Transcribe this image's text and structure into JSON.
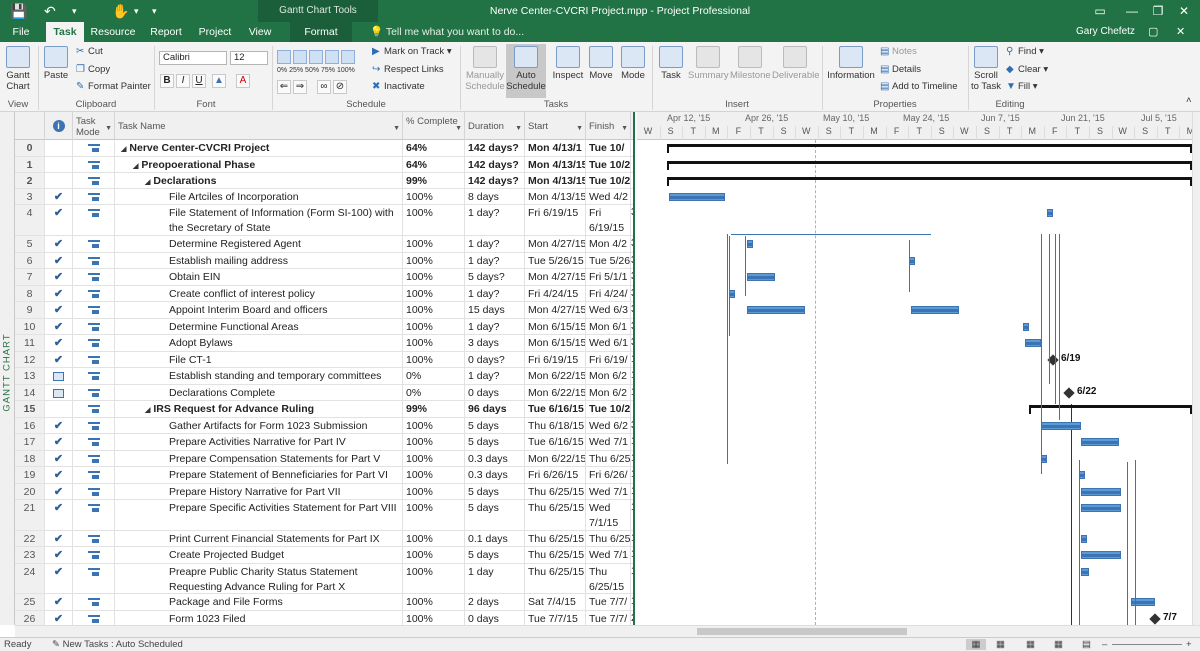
{
  "window": {
    "title": "Nerve Center-CVCRI Project.mpp - Project Professional",
    "context_tab_group": "Gantt Chart Tools",
    "user": "Gary Chefetz"
  },
  "tabs": [
    {
      "label": "File"
    },
    {
      "label": "Task",
      "active": true
    },
    {
      "label": "Resource"
    },
    {
      "label": "Report"
    },
    {
      "label": "Project"
    },
    {
      "label": "View"
    },
    {
      "label": "Format"
    }
  ],
  "tell_me": "Tell me what you want to do...",
  "ribbon": {
    "view": {
      "gantt": "Gantt Chart",
      "group": "View"
    },
    "clipboard": {
      "paste": "Paste",
      "cut": "Cut",
      "copy": "Copy",
      "painter": "Format Painter",
      "group": "Clipboard"
    },
    "font": {
      "name": "Calibri",
      "size": "12",
      "bold": "B",
      "italic": "I",
      "underline": "U",
      "group": "Font"
    },
    "schedule": {
      "mark_on_track": "Mark on Track",
      "respect_links": "Respect Links",
      "inactivate": "Inactivate",
      "pct": [
        "0%",
        "25%",
        "50%",
        "75%",
        "100%"
      ],
      "group": "Schedule"
    },
    "tasks": {
      "manually": "Manually Schedule",
      "auto": "Auto Schedule",
      "inspect": "Inspect",
      "move": "Move",
      "mode": "Mode",
      "group": "Tasks"
    },
    "insert": {
      "task": "Task",
      "summary": "Summary",
      "milestone": "Milestone",
      "deliverable": "Deliverable",
      "group": "Insert"
    },
    "properties": {
      "information": "Information",
      "notes": "Notes",
      "details": "Details",
      "add_timeline": "Add to Timeline",
      "group": "Properties"
    },
    "editing": {
      "scroll": "Scroll to Task",
      "find": "Find",
      "clear": "Clear",
      "fill": "Fill",
      "group": "Editing"
    }
  },
  "side_label": "GANTT CHART",
  "columns": {
    "info": "i",
    "mode": "Task Mode",
    "name": "Task Name",
    "pct": "% Complete",
    "duration": "Duration",
    "start": "Start",
    "finish": "Finish",
    "pred": "P"
  },
  "rows": [
    {
      "id": "0",
      "check": false,
      "level": 0,
      "summary": true,
      "name": "Nerve Center-CVCRI Project",
      "pct": "64%",
      "duration": "142 days?",
      "start": "Mon 4/13/1",
      "finish": "Tue 10/",
      "pred": "",
      "h": 17
    },
    {
      "id": "1",
      "check": false,
      "level": 1,
      "summary": true,
      "name": "Preopoerational Phase",
      "pct": "64%",
      "duration": "142 days?",
      "start": "Mon 4/13/15",
      "finish": "Tue 10/2",
      "pred": "",
      "h": 16
    },
    {
      "id": "2",
      "check": false,
      "level": 2,
      "summary": true,
      "name": "Declarations",
      "pct": "99%",
      "duration": "142 days?",
      "start": "Mon 4/13/15",
      "finish": "Tue 10/2",
      "pred": "",
      "h": 16
    },
    {
      "id": "3",
      "check": true,
      "level": 3,
      "summary": false,
      "name": "File Artciles of Incorporation",
      "pct": "100%",
      "duration": "8 days",
      "start": "Mon 4/13/15",
      "finish": "Wed 4/2",
      "pred": "",
      "h": 16
    },
    {
      "id": "4",
      "check": true,
      "level": 3,
      "summary": false,
      "name": "File Statement of Information (Form SI-100) with the Secretary of State",
      "pct": "100%",
      "duration": "1 day?",
      "start": "Fri 6/19/15",
      "finish": "Fri 6/19/15",
      "pred": "3",
      "h": 31
    },
    {
      "id": "5",
      "check": true,
      "level": 3,
      "summary": false,
      "name": "Determine Registered Agent",
      "pct": "100%",
      "duration": "1 day?",
      "start": "Mon 4/27/15",
      "finish": "Mon 4/2",
      "pred": "3",
      "h": 17
    },
    {
      "id": "6",
      "check": true,
      "level": 3,
      "summary": false,
      "name": "Establish mailing address",
      "pct": "100%",
      "duration": "1 day?",
      "start": "Tue 5/26/15",
      "finish": "Tue 5/26",
      "pred": "3",
      "h": 16
    },
    {
      "id": "7",
      "check": true,
      "level": 3,
      "summary": false,
      "name": "Obtain EIN",
      "pct": "100%",
      "duration": "5 days?",
      "start": "Mon 4/27/15",
      "finish": "Fri 5/1/1",
      "pred": "3",
      "h": 17
    },
    {
      "id": "8",
      "check": true,
      "level": 3,
      "summary": false,
      "name": "Create conflict of interest policy",
      "pct": "100%",
      "duration": "1 day?",
      "start": "Fri 4/24/15",
      "finish": "Fri 4/24/",
      "pred": "3",
      "h": 16
    },
    {
      "id": "9",
      "check": true,
      "level": 3,
      "summary": false,
      "name": "Appoint Interim Board and officers",
      "pct": "100%",
      "duration": "15 days",
      "start": "Mon 4/27/15",
      "finish": "Wed 6/3",
      "pred": "3",
      "h": 17
    },
    {
      "id": "10",
      "check": true,
      "level": 3,
      "summary": false,
      "name": "Determine Functional Areas",
      "pct": "100%",
      "duration": "1 day?",
      "start": "Mon 6/15/15",
      "finish": "Mon 6/1",
      "pred": "3",
      "h": 16
    },
    {
      "id": "11",
      "check": true,
      "level": 3,
      "summary": false,
      "name": "Adopt Bylaws",
      "pct": "100%",
      "duration": "3 days",
      "start": "Mon 6/15/15",
      "finish": "Wed 6/1",
      "pred": "3",
      "h": 17
    },
    {
      "id": "12",
      "check": true,
      "level": 3,
      "summary": false,
      "name": "File CT-1",
      "pct": "100%",
      "duration": "0 days?",
      "start": "Fri 6/19/15",
      "finish": "Fri 6/19/",
      "pred": "1",
      "h": 16
    },
    {
      "id": "13",
      "check": false,
      "cal": true,
      "level": 3,
      "summary": false,
      "name": "Establish standing and temporary committees",
      "pct": "0%",
      "duration": "1 day?",
      "start": "Mon 6/22/15",
      "finish": "Mon 6/2",
      "pred": "1",
      "h": 17
    },
    {
      "id": "14",
      "check": false,
      "cal": true,
      "level": 3,
      "summary": false,
      "name": "Declarations Complete",
      "pct": "0%",
      "duration": "0 days",
      "start": "Mon 6/22/15",
      "finish": "Mon 6/2",
      "pred": "1",
      "h": 16
    },
    {
      "id": "15",
      "check": false,
      "level": 2,
      "summary": true,
      "name": "IRS Request for Advance Ruling",
      "pct": "99%",
      "duration": "96 days",
      "start": "Tue 6/16/15",
      "finish": "Tue 10/2",
      "pred": "",
      "h": 17
    },
    {
      "id": "16",
      "check": true,
      "level": 3,
      "summary": false,
      "name": "Gather Artifacts for Form 1023 Submission",
      "pct": "100%",
      "duration": "5 days",
      "start": "Thu 6/18/15",
      "finish": "Wed 6/2",
      "pred": "3",
      "h": 16
    },
    {
      "id": "17",
      "check": true,
      "level": 3,
      "summary": false,
      "name": "Prepare Activities Narrative for Part IV",
      "pct": "100%",
      "duration": "5 days",
      "start": "Tue 6/16/15",
      "finish": "Wed 7/1",
      "pred": "1",
      "h": 17
    },
    {
      "id": "18",
      "check": true,
      "level": 3,
      "summary": false,
      "name": "Prepare Compensation Statements for Part V",
      "pct": "100%",
      "duration": "0.3 days",
      "start": "Mon 6/22/15",
      "finish": "Thu 6/25",
      "pred": "1",
      "h": 16
    },
    {
      "id": "19",
      "check": true,
      "level": 3,
      "summary": false,
      "name": "Prepare Statement of Benneficiaries for Part VI",
      "pct": "100%",
      "duration": "0.3 days",
      "start": "Fri 6/26/15",
      "finish": "Fri 6/26/",
      "pred": "1",
      "h": 17
    },
    {
      "id": "20",
      "check": true,
      "level": 3,
      "summary": false,
      "name": "Prepare History Narrative for Part VII",
      "pct": "100%",
      "duration": "5 days",
      "start": "Thu 6/25/15",
      "finish": "Wed 7/1",
      "pred": "1",
      "h": 16
    },
    {
      "id": "21",
      "check": true,
      "level": 3,
      "summary": false,
      "name": "Prepare Specific Activities Statement for Part VIII",
      "pct": "100%",
      "duration": "5 days",
      "start": "Thu 6/25/15",
      "finish": "Wed 7/1/15",
      "pred": "1",
      "h": 31
    },
    {
      "id": "22",
      "check": true,
      "level": 3,
      "summary": false,
      "name": "Print Current Financial Statements for Part IX",
      "pct": "100%",
      "duration": "0.1 days",
      "start": "Thu 6/25/15",
      "finish": "Thu 6/25",
      "pred": "1",
      "h": 16
    },
    {
      "id": "23",
      "check": true,
      "level": 3,
      "summary": false,
      "name": "Create Projected Budget",
      "pct": "100%",
      "duration": "5 days",
      "start": "Thu 6/25/15",
      "finish": "Wed 7/1",
      "pred": "1",
      "h": 17
    },
    {
      "id": "24",
      "check": true,
      "level": 3,
      "summary": false,
      "name": "Preapre  Public Charity Status Statement Requesting Advance Ruling for Part X",
      "pct": "100%",
      "duration": "1 day",
      "start": "Thu 6/25/15",
      "finish": "Thu 6/25/15",
      "pred": "1",
      "h": 30
    },
    {
      "id": "25",
      "check": true,
      "level": 3,
      "summary": false,
      "name": "Package and File Forms",
      "pct": "100%",
      "duration": "2 days",
      "start": "Sat 7/4/15",
      "finish": "Tue 7/7/",
      "pred": "1",
      "h": 17
    },
    {
      "id": "26",
      "check": true,
      "level": 3,
      "summary": false,
      "name": "Form 1023 Filed",
      "pct": "100%",
      "duration": "0 days",
      "start": "Tue 7/7/15",
      "finish": "Tue 7/7/",
      "pred": "2",
      "h": 16
    }
  ],
  "timescale": {
    "weeks": [
      "Apr 12, '15",
      "Apr 26, '15",
      "May 10, '15",
      "May 24, '15",
      "Jun 7, '15",
      "Jun 21, '15",
      "Jul 5, '15"
    ],
    "days": [
      "W",
      "S",
      "T",
      "M",
      "F",
      "T",
      "S",
      "W",
      "S",
      "T",
      "M",
      "F",
      "T",
      "S",
      "W",
      "S",
      "T",
      "M",
      "F",
      "T",
      "S",
      "W",
      "S",
      "T",
      "M",
      "F",
      "T",
      "S"
    ]
  },
  "milestones": {
    "m12": "6/19",
    "m14": "6/22",
    "m26": "7/7"
  },
  "status": {
    "ready": "Ready",
    "new_tasks": "New Tasks : Auto Scheduled"
  }
}
